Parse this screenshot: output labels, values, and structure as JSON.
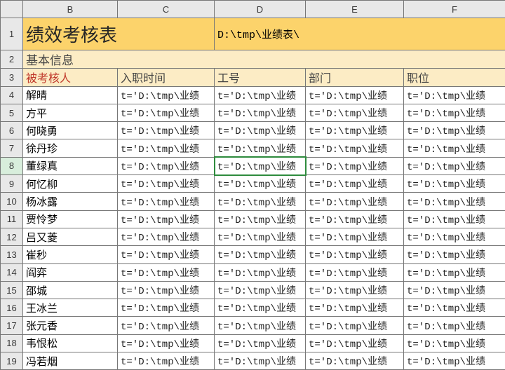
{
  "cols": [
    "B",
    "C",
    "D",
    "E",
    "F"
  ],
  "rows": [
    "1",
    "2",
    "3",
    "4",
    "5",
    "6",
    "7",
    "8",
    "9",
    "10",
    "11",
    "12",
    "13",
    "14",
    "15",
    "16",
    "17",
    "18",
    "19"
  ],
  "title": "绩效考核表",
  "path": "D:\\tmp\\业绩表\\",
  "section": "基本信息",
  "headers": {
    "B": "被考核人",
    "C": "入职时间",
    "D": "工号",
    "E": "部门",
    "F": "职位"
  },
  "names": [
    "解晴",
    "方平",
    "何晓勇",
    "徐丹珍",
    "董绿真",
    "何忆柳",
    "杨冰露",
    "贾怜梦",
    "吕又菱",
    "崔秒",
    "阎弈",
    "邵城",
    "王冰兰",
    "张元香",
    "韦恨松",
    "冯若烟"
  ],
  "formula": "t='D:\\tmp\\业绩",
  "selected": {
    "row": 8,
    "col": "D"
  }
}
